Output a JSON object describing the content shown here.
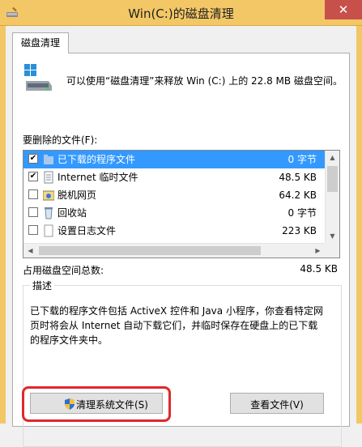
{
  "window": {
    "title": "Win(C:)的磁盘清理",
    "close_label": "✕"
  },
  "tab": {
    "label": "磁盘清理"
  },
  "summary": {
    "text": "可以使用“磁盘清理”来释放 Win (C:) 上的 22.8 MB 磁盘空间。"
  },
  "files": {
    "label": "要删除的文件(F):",
    "items": [
      {
        "name": "已下载的程序文件",
        "size": "0 字节",
        "checked": true,
        "selected": true,
        "icon": "folder-icon"
      },
      {
        "name": "Internet 临时文件",
        "size": "48.5 KB",
        "checked": true,
        "selected": false,
        "icon": "document-icon"
      },
      {
        "name": "脱机网页",
        "size": "64.2 KB",
        "checked": false,
        "selected": false,
        "icon": "offline-pages-icon"
      },
      {
        "name": "回收站",
        "size": "0 字节",
        "checked": false,
        "selected": false,
        "icon": "recycle-bin-icon"
      },
      {
        "name": "设置日志文件",
        "size": "223 KB",
        "checked": false,
        "selected": false,
        "icon": "log-file-icon"
      }
    ]
  },
  "total": {
    "label": "占用磁盘空间总数:",
    "value": "48.5 KB"
  },
  "description": {
    "legend": "描述",
    "text": "已下载的程序文件包括 ActiveX 控件和 Java 小程序，你查看特定网\n页时将会从 Internet 自动下载它们，并临时保存在硬盘上的已下载\n的程序文件夹中。"
  },
  "buttons": {
    "clean_system": "清理系统文件(S)",
    "view_files": "查看文件(V)"
  },
  "colors": {
    "titlebar": "#f3c766",
    "selection": "#3399ff",
    "highlight_ring": "#e0282c",
    "close_button": "#c7504a"
  }
}
